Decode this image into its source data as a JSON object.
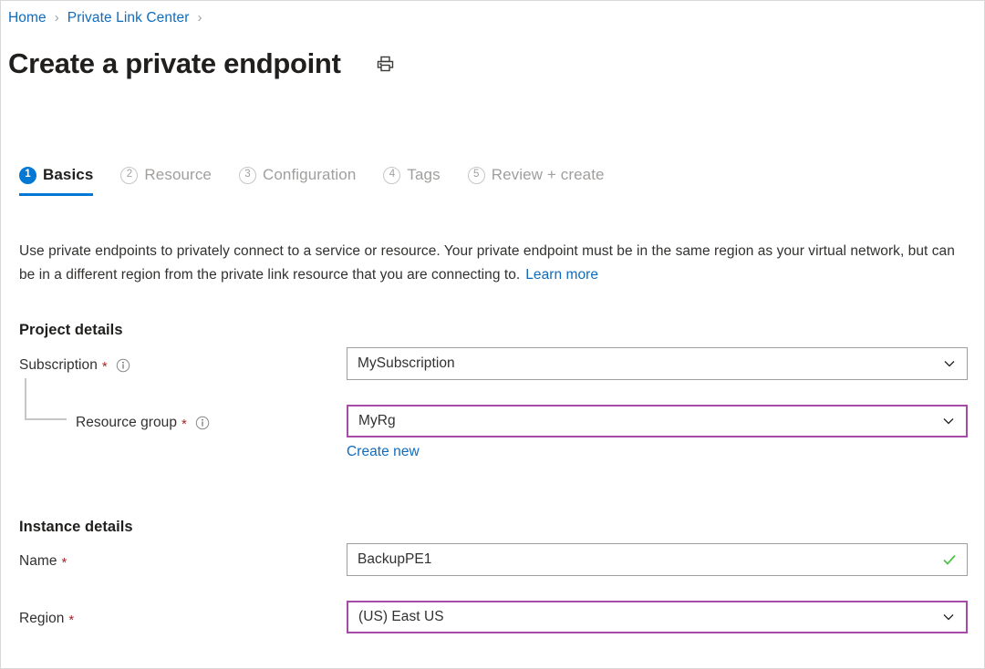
{
  "breadcrumb": {
    "items": [
      {
        "label": "Home"
      },
      {
        "label": "Private Link Center"
      }
    ],
    "separator": "›"
  },
  "header": {
    "title": "Create a private endpoint",
    "print_icon": "printer-icon"
  },
  "wizard": {
    "tabs": [
      {
        "number": "1",
        "label": "Basics",
        "state": "active"
      },
      {
        "number": "2",
        "label": "Resource",
        "state": "inactive"
      },
      {
        "number": "3",
        "label": "Configuration",
        "state": "inactive"
      },
      {
        "number": "4",
        "label": "Tags",
        "state": "inactive"
      },
      {
        "number": "5",
        "label": "Review + create",
        "state": "inactive"
      }
    ]
  },
  "description": {
    "text": "Use private endpoints to privately connect to a service or resource. Your private endpoint must be in the same region as your virtual network, but can be in a different region from the private link resource that you are connecting to.",
    "link_label": "Learn more"
  },
  "project_details": {
    "heading": "Project details",
    "subscription": {
      "label": "Subscription",
      "required_marker": "*",
      "info_icon": "info-icon",
      "value": "MySubscription",
      "chevron_icon": "chevron-down-icon",
      "highlighted": false
    },
    "resource_group": {
      "label": "Resource group",
      "required_marker": "*",
      "info_icon": "info-icon",
      "value": "MyRg",
      "chevron_icon": "chevron-down-icon",
      "highlighted": true,
      "create_new_label": "Create new"
    }
  },
  "instance_details": {
    "heading": "Instance details",
    "name": {
      "label": "Name",
      "required_marker": "*",
      "value": "BackupPE1",
      "validation_icon": "checkmark-icon",
      "highlighted": false
    },
    "region": {
      "label": "Region",
      "required_marker": "*",
      "value": "(US) East US",
      "chevron_icon": "chevron-down-icon",
      "highlighted": true
    }
  },
  "colors": {
    "link": "#0f6cbd",
    "accent": "#0078d4",
    "required": "#a4262c",
    "highlight_border": "#a64ca6",
    "valid_check": "#4ac144",
    "border": "#a19f9d",
    "muted_text": "#a19f9d"
  }
}
